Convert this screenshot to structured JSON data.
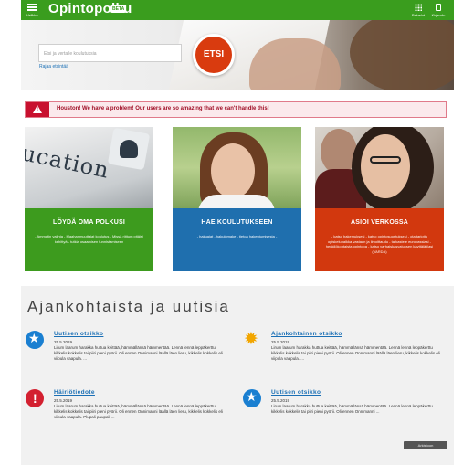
{
  "header": {
    "menu_label": "Valikko",
    "logo": "Opintopolku",
    "beta": "BETA",
    "right_items": [
      {
        "label": "Palvelut",
        "icon": "grid-icon"
      },
      {
        "label": "Kirjaudu",
        "icon": "mobile-icon"
      }
    ]
  },
  "hero": {
    "search_placeholder": "Etsi ja vertaile koulutuksia",
    "advanced_link": "Rajaa etsintää",
    "search_button": "ETSI"
  },
  "alert": {
    "text": "Houston! We have a problem! Our users are so amazing that we can't handle this!"
  },
  "cards": [
    {
      "title": "LÖYDÄ OMA POLKUSI",
      "description": "- Ammatin valinta - Maahanmuuttajat koulutus - Missä riittum pitäisi kehittyä - tutkia osaamisen tunnistamiseen",
      "image_text": "ucation",
      "color": "#3d9b1e"
    },
    {
      "title": "HAE KOULUTUKSEEN",
      "description": "- hakuajat - hakulomake - tietoa hakeutumisesta -",
      "color": "#1f6fae"
    },
    {
      "title": "ASIOI VERKOSSA",
      "description": "- katso hakemuksesi - katso opintosuorituksesi - ota tarjottu opiskelupaikka vastaan ja ilmoittaudu - tarkastele europassiasi - henkilökohtaista opintopa - katso varhaiskasvatuksen käyttäjätilasi (VARDA)",
      "color": "#d2380e"
    }
  ],
  "news": {
    "heading": "Ajankohtaista ja uutisia",
    "items": [
      {
        "title": "Uutisen otsikko",
        "date": "25.5.2019",
        "body": "Lirum laarum harakka huttua keittää, hämmällänsä hämmentää. Lennä lennä leppäkerttu kikkelis kokkelis tai piiri pieni pyörii. Oli ennen Onnimanni läällä läen lieru, kikkelis kokkelis eli viipula vaapula. ...",
        "icon": "star-icon"
      },
      {
        "title": "Ajankohtainen otsikko",
        "date": "25.5.2019",
        "body": "Lirum laarum harakka huttua keittää, hämmällänsä hämmentää. Lennä lennä leppäkerttu kikkelis kokkelis tai piiri pieni pyörii. Oli ennen Onnimanni läällä läen lieru, kikkelis kokkelis eli viipula vaapula. ...",
        "icon": "sun-icon"
      },
      {
        "title": "Häiriötiedote",
        "date": "25.5.2019",
        "body": "Lirum laarum harakka huttua keittää, hämmällänsä hämmentää. Lennä lennä leppäkerttu kikkelis kokkelis tai piiri pieni pyörii. Oli ennen Onnimanni läällä läen lieru, kikkelis kokkelis eli viipula vaapula. Plupali paupali ...",
        "icon": "warning-icon"
      },
      {
        "title": "Uutisen otsikko",
        "date": "25.5.2019",
        "body": "Lirum laarum harakka huttua keittää, hämmällänsä hämmentää. Lennä lennä leppäkerttu kikkelis kokkelis tai piiri pieni pyörii. Oli ennen Onnimanni ...",
        "icon": "star-icon"
      }
    ],
    "archive_button": "Arkistoon"
  }
}
